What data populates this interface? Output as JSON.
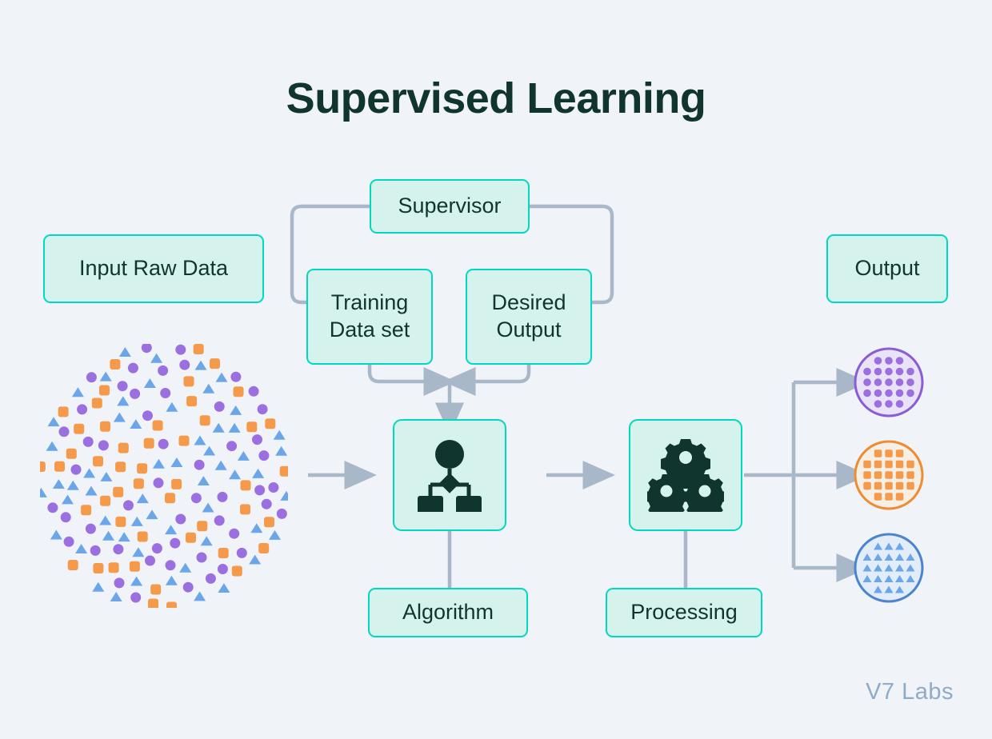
{
  "page": {
    "title": "Supervised Learning",
    "watermark": "V7 Labs",
    "background_color": "#f0f3f8",
    "title_color": "#10352f"
  },
  "palette": {
    "box_fill": "#d6f2ed",
    "box_border": "#00d9c0",
    "box_text": "#10352f",
    "connector": "#a9b8c9",
    "purple": "#9b6fdf",
    "orange": "#f59a4b",
    "blue": "#6aa6e8",
    "watermark": "#8fabc9"
  },
  "boxes": {
    "input_raw_data": {
      "label": "Input Raw Data"
    },
    "supervisor": {
      "label": "Supervisor"
    },
    "training_data_set": {
      "label": "Training\nData set",
      "line1": "Training",
      "line2": "Data set"
    },
    "desired_output": {
      "label": "Desired\nOutput",
      "line1": "Desired",
      "line2": "Output"
    },
    "output": {
      "label": "Output"
    },
    "algorithm": {
      "label": "Algorithm",
      "icon": "hierarchy-icon"
    },
    "processing": {
      "label": "Processing",
      "icon": "gears-icon"
    }
  },
  "scatter_cloud": {
    "name": "raw-data-scatter",
    "shape_types": [
      "circle",
      "square",
      "triangle"
    ],
    "counts": {
      "circle": 52,
      "square": 48,
      "triangle": 58
    },
    "colors": {
      "circle": "#9b6fdf",
      "square": "#f59a4b",
      "triangle": "#6aa6e8"
    }
  },
  "output_clusters": [
    {
      "name": "purple-circles-cluster",
      "shape": "circle",
      "color": "#9b6fdf",
      "ring_color": "#8a5cd6",
      "fill": "#e8e3f7",
      "rows": [
        3,
        5,
        5,
        5,
        3
      ],
      "count": 21
    },
    {
      "name": "orange-squares-cluster",
      "shape": "square",
      "color": "#f59a4b",
      "ring_color": "#ee8c33",
      "fill": "#f6efe6",
      "rows": [
        3,
        5,
        5,
        5,
        3
      ],
      "count": 21
    },
    {
      "name": "blue-triangles-cluster",
      "shape": "triangle",
      "color": "#6aa6e8",
      "ring_color": "#4a84cf",
      "fill": "#e3edfa",
      "rows": [
        3,
        5,
        5,
        5,
        3
      ],
      "count": 21
    }
  ],
  "connectors": [
    {
      "name": "input-to-algorithm-arrow",
      "from": "raw-data-scatter",
      "to": "algorithm",
      "arrow": true
    },
    {
      "name": "supervisor-to-training-line",
      "from": "supervisor",
      "to": "training_data_set",
      "arrow": false
    },
    {
      "name": "supervisor-to-desired-line",
      "from": "supervisor",
      "to": "desired_output",
      "arrow": false
    },
    {
      "name": "training-to-merge-arrow",
      "from": "training_data_set",
      "to": "merge-point",
      "arrow": true
    },
    {
      "name": "desired-to-merge-arrow",
      "from": "desired_output",
      "to": "merge-point",
      "arrow": true
    },
    {
      "name": "merge-to-algorithm-arrow",
      "from": "merge-point",
      "to": "algorithm",
      "arrow": true
    },
    {
      "name": "algorithm-to-label-line",
      "from": "algorithm",
      "to": "algorithm-label",
      "arrow": false
    },
    {
      "name": "algorithm-to-processing-arrow",
      "from": "algorithm",
      "to": "processing",
      "arrow": true
    },
    {
      "name": "processing-to-label-line",
      "from": "processing",
      "to": "processing-label",
      "arrow": false
    },
    {
      "name": "processing-to-cluster-1-arrow",
      "from": "processing",
      "to": "purple-circles-cluster",
      "arrow": true
    },
    {
      "name": "processing-to-cluster-2-arrow",
      "from": "processing",
      "to": "orange-squares-cluster",
      "arrow": true
    },
    {
      "name": "processing-to-cluster-3-arrow",
      "from": "processing",
      "to": "blue-triangles-cluster",
      "arrow": true
    }
  ]
}
